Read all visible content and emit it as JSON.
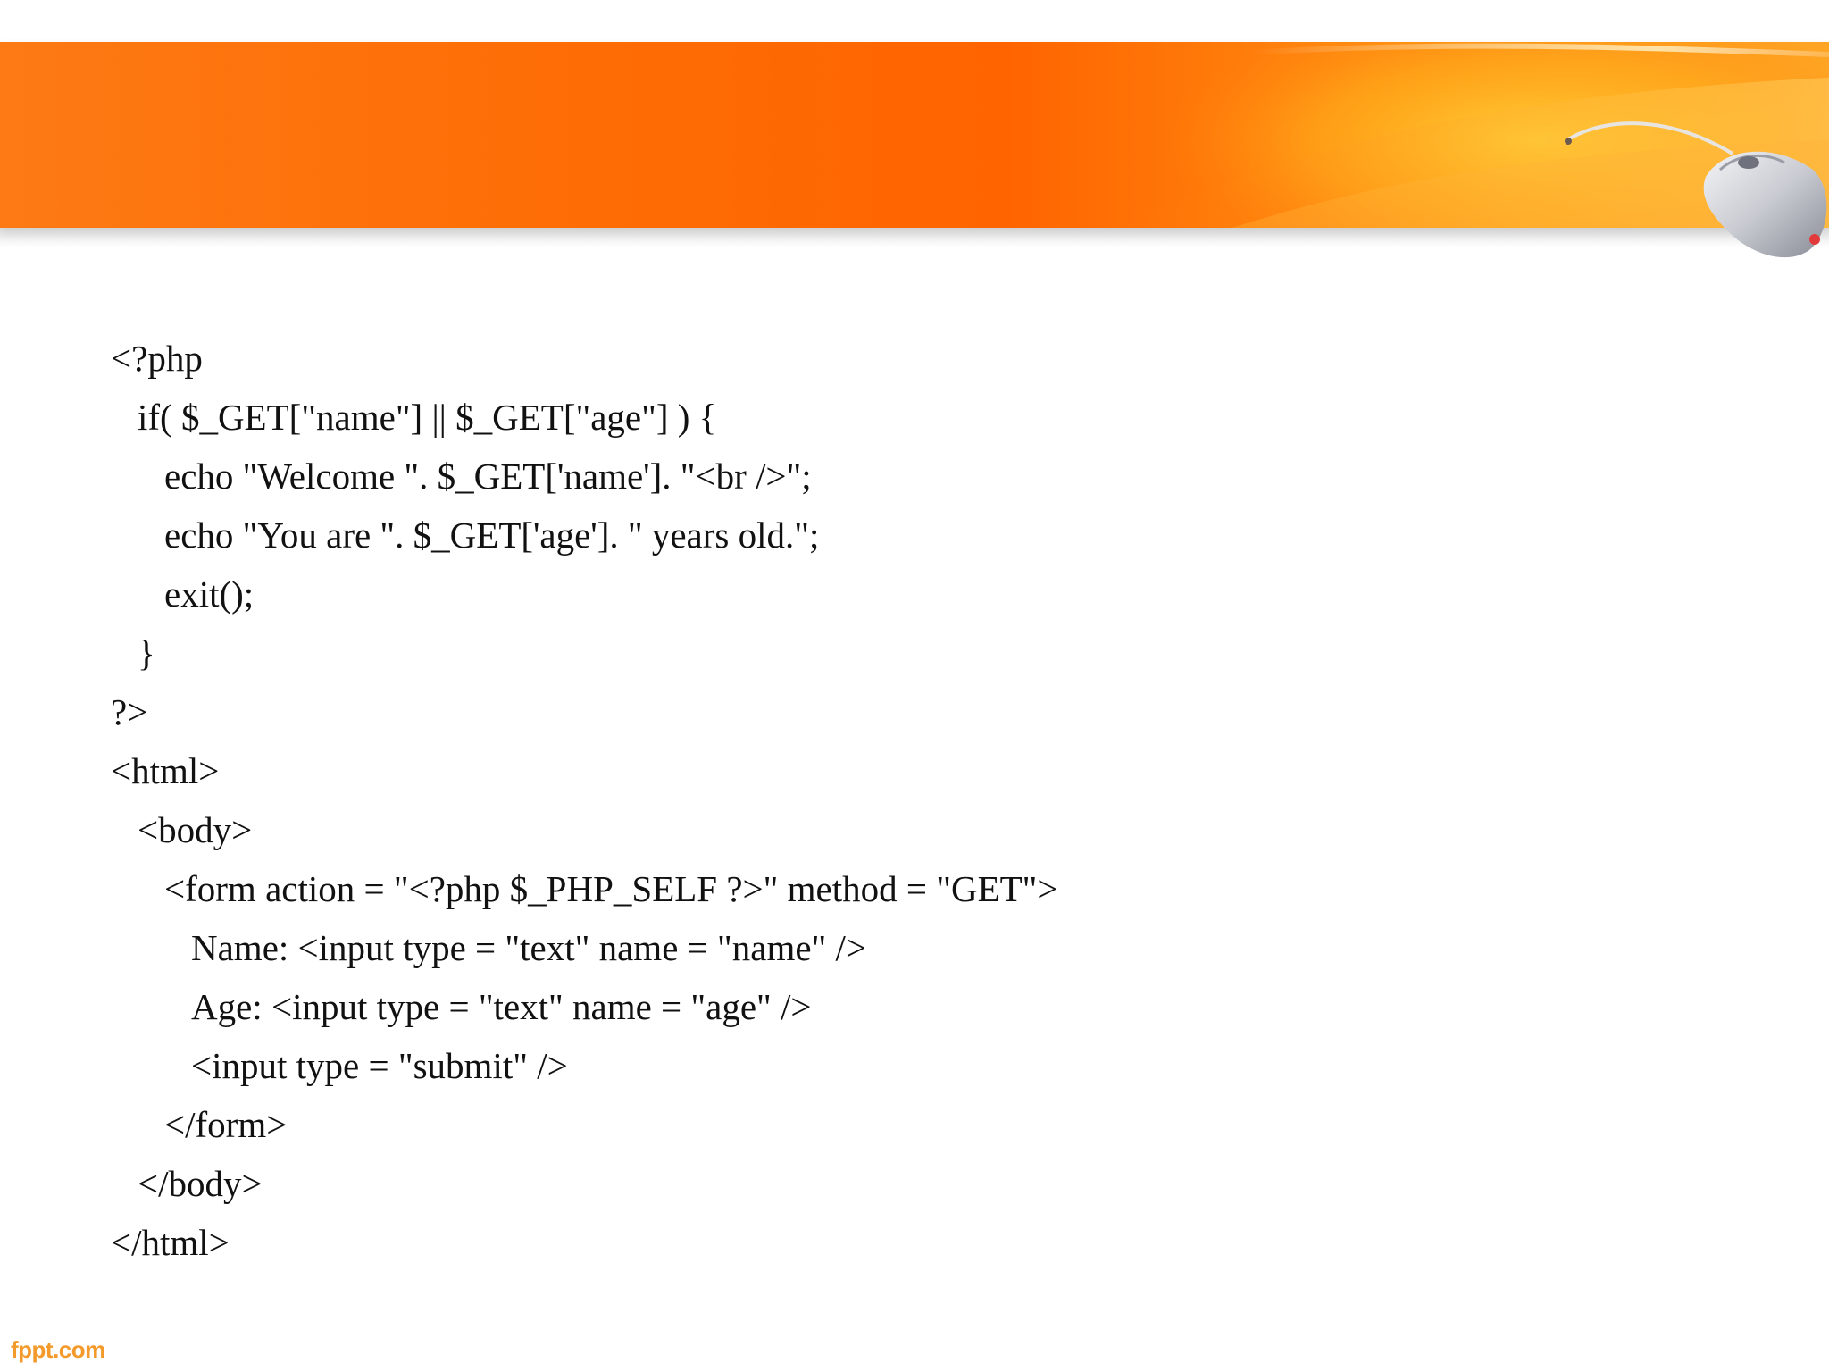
{
  "slide": {
    "code_lines": [
      {
        "text": "<?php",
        "indent": 0
      },
      {
        "text": "if( $_GET[\"name\"] || $_GET[\"age\"] ) {",
        "indent": 1
      },
      {
        "text": "echo \"Welcome \". $_GET['name']. \"<br />\";",
        "indent": 2
      },
      {
        "text": "echo \"You are \". $_GET['age']. \" years old.\";",
        "indent": 2
      },
      {
        "text": "exit();",
        "indent": 2
      },
      {
        "text": "}",
        "indent": 1
      },
      {
        "text": "?>",
        "indent": 0
      },
      {
        "text": "<html>",
        "indent": 0
      },
      {
        "text": "<body>",
        "indent": 1
      },
      {
        "text": "<form action = \"<?php $_PHP_SELF ?>\" method = \"GET\">",
        "indent": 2
      },
      {
        "text": "Name: <input type = \"text\" name = \"name\" />",
        "indent": 3
      },
      {
        "text": "Age: <input type = \"text\" name = \"age\" />",
        "indent": 3
      },
      {
        "text": "<input type = \"submit\" />",
        "indent": 3
      },
      {
        "text": "</form>",
        "indent": 2
      },
      {
        "text": "</body>",
        "indent": 1
      },
      {
        "text": "</html>",
        "indent": 0
      }
    ],
    "footer_brand": "fppt.com"
  },
  "colors": {
    "banner_primary": "#ff6400",
    "banner_highlight": "#ffa524",
    "footer_brand": "#f39a2b",
    "code_text": "#111111"
  },
  "icons": {
    "banner_decoration": "computer-mouse-icon"
  }
}
